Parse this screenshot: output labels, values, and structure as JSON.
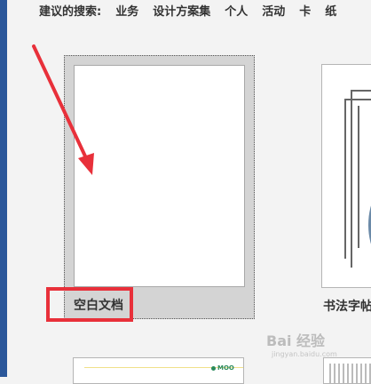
{
  "search": {
    "label": "建议的搜索:",
    "suggestions": [
      "业务",
      "设计方案集",
      "个人",
      "活动",
      "卡",
      "纸"
    ]
  },
  "templates": {
    "blank": {
      "label": "空白文档"
    },
    "calligraphy": {
      "label": "书法字帖"
    },
    "bottom_logo": "MOO"
  },
  "annotation": {
    "arrow_color": "#e8303a",
    "box_color": "#e8303a"
  },
  "watermark": {
    "brand": "Bai 经验",
    "url": "jingyan.baidu.com"
  },
  "colors": {
    "accent_strip": "#2b579a"
  }
}
